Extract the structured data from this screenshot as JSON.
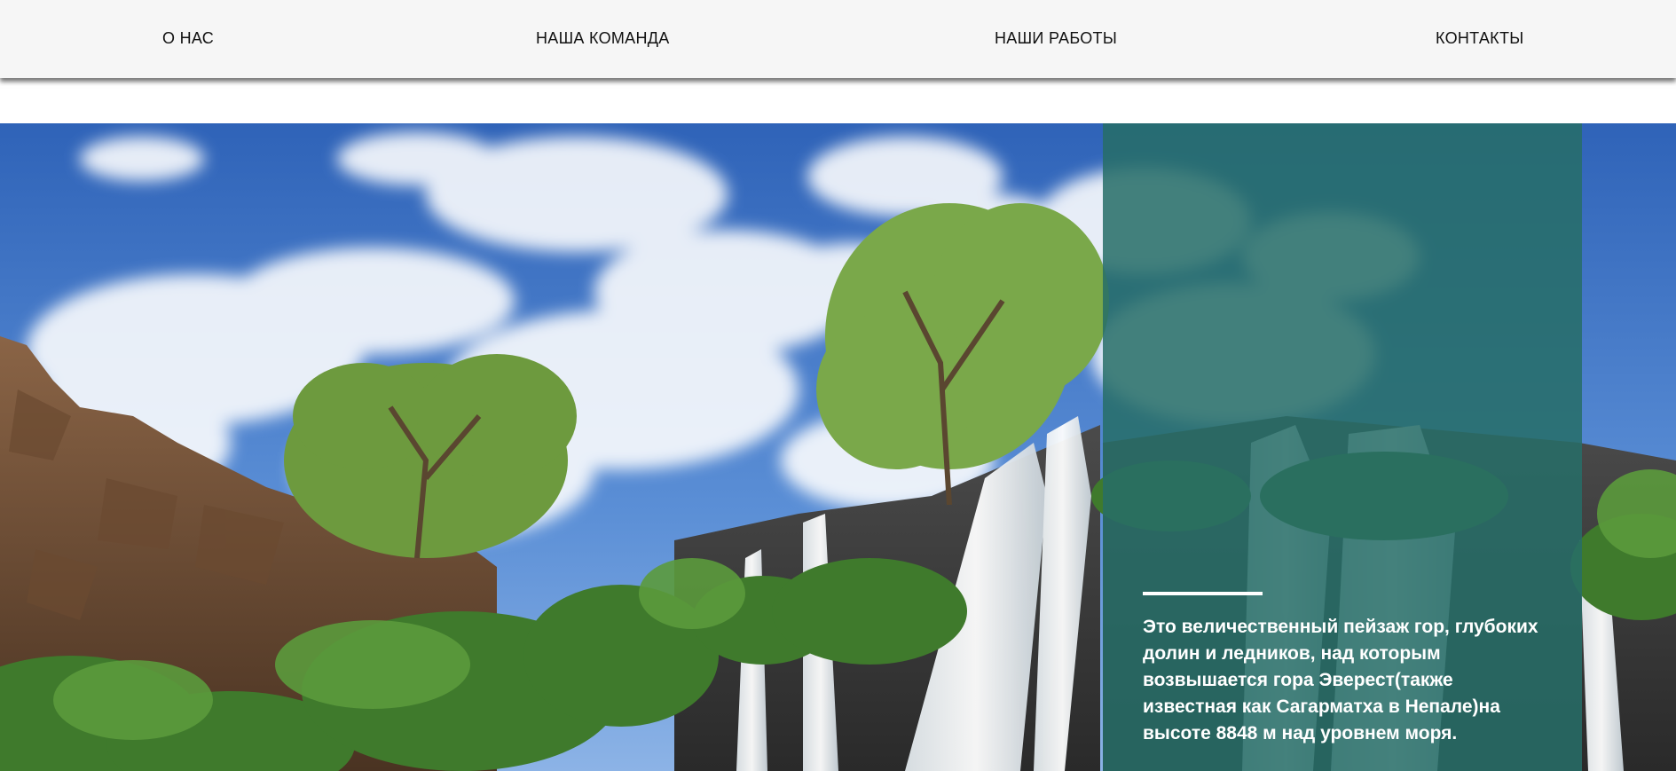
{
  "nav": {
    "items": [
      {
        "label": "О НАС"
      },
      {
        "label": "НАША КОМАНДА"
      },
      {
        "label": "НАШИ РАБОТЫ"
      },
      {
        "label": "КОНТАКТЫ"
      }
    ]
  },
  "hero": {
    "image_subject": "waterfall-landscape",
    "panel": {
      "text": "Это величественный пейзаж гор, глубоких долин и ледников, над которым возвышается гора Эверест(также известная как Сагарматха в Непале)на высоте 8848 м над уровнем моря.",
      "color": "#266e68"
    }
  }
}
